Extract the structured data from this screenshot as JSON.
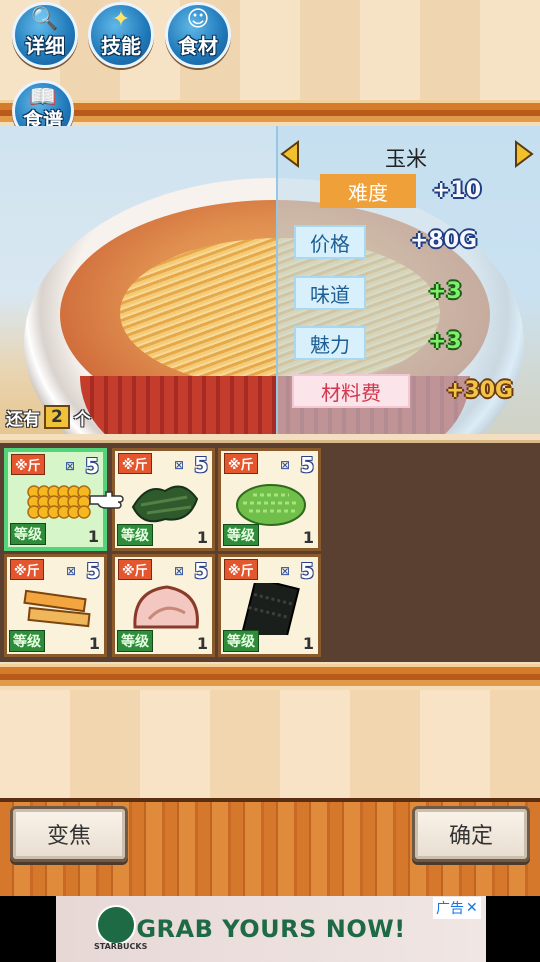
{
  "toolbar": {
    "buttons": [
      {
        "label": "详细",
        "icon": "magnifier-icon"
      },
      {
        "label": "技能",
        "icon": "sparkle-icon"
      },
      {
        "label": "食材",
        "icon": "chef-icon"
      }
    ],
    "recipe": {
      "label": "食谱",
      "icon": "book-icon"
    }
  },
  "ingredient": {
    "name": "玉米"
  },
  "stats": {
    "difficulty": {
      "label": "难度",
      "value": "+10"
    },
    "price": {
      "label": "价格",
      "value": "+80G"
    },
    "taste": {
      "label": "味道",
      "value": "+3"
    },
    "charm": {
      "label": "魅力",
      "value": "+3"
    },
    "cost": {
      "label": "材料费",
      "value": "+30G"
    }
  },
  "remaining": {
    "prefix": "还有",
    "count": "2",
    "suffix": "个"
  },
  "cards": [
    {
      "badge": "※斤",
      "qty_mark": "⊠",
      "qty": "5",
      "grade": "等级",
      "level": "1",
      "food": "corn",
      "selected": true
    },
    {
      "badge": "※斤",
      "qty_mark": "⊠",
      "qty": "5",
      "grade": "等级",
      "level": "1",
      "food": "seaweed-dark",
      "selected": false
    },
    {
      "badge": "※斤",
      "qty_mark": "⊠",
      "qty": "5",
      "grade": "等级",
      "level": "1",
      "food": "green-onion",
      "selected": false
    },
    {
      "badge": "※斤",
      "qty_mark": "⊠",
      "qty": "5",
      "grade": "等级",
      "level": "1",
      "food": "bamboo-shoots",
      "selected": false
    },
    {
      "badge": "※斤",
      "qty_mark": "⊠",
      "qty": "5",
      "grade": "等级",
      "level": "1",
      "food": "chashu-pork",
      "selected": false
    },
    {
      "badge": "※斤",
      "qty_mark": "⊠",
      "qty": "5",
      "grade": "等级",
      "level": "1",
      "food": "nori",
      "selected": false
    }
  ],
  "bottom": {
    "zoom_label": "变焦",
    "confirm_label": "确定"
  },
  "ad": {
    "text": "GRAB YOURS NOW!",
    "brand": "STARBUCKS",
    "tag": "广告",
    "close": "✕"
  },
  "colors": {
    "accent_blue": "#1f78b8",
    "wood": "#d5782c",
    "selected_border": "#53d47a"
  }
}
